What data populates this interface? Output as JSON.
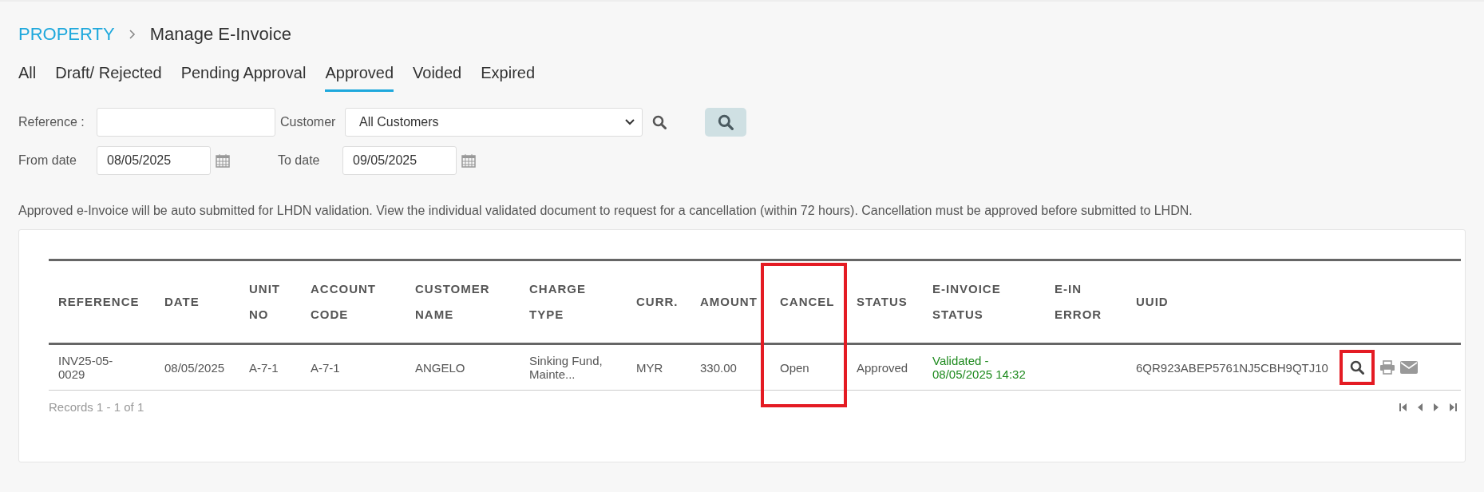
{
  "breadcrumb": {
    "parent": "PROPERTY",
    "current": "Manage E-Invoice"
  },
  "tabs": [
    {
      "label": "All",
      "selected": false
    },
    {
      "label": "Draft/ Rejected",
      "selected": false
    },
    {
      "label": "Pending Approval",
      "selected": false
    },
    {
      "label": "Approved",
      "selected": true
    },
    {
      "label": "Voided",
      "selected": false
    },
    {
      "label": "Expired",
      "selected": false
    }
  ],
  "filters": {
    "reference_label": "Reference :",
    "customer_label": "Customer",
    "customer_value": "All Customers",
    "from_label": "From date",
    "from_value": "08/05/2025",
    "to_label": "To date",
    "to_value": "09/05/2025"
  },
  "note": "Approved e-Invoice will be auto submitted for LHDN validation. View the individual validated document to request for a cancellation (within 72 hours). Cancellation must be approved before submitted to LHDN.",
  "table": {
    "columns": [
      {
        "lines": [
          "REFERENCE"
        ]
      },
      {
        "lines": [
          "DATE"
        ]
      },
      {
        "lines": [
          "UNIT",
          "NO"
        ]
      },
      {
        "lines": [
          "ACCOUNT",
          "CODE"
        ]
      },
      {
        "lines": [
          "CUSTOMER",
          "NAME"
        ]
      },
      {
        "lines": [
          "CHARGE",
          "TYPE"
        ]
      },
      {
        "lines": [
          "CURR."
        ]
      },
      {
        "lines": [
          "AMOUNT"
        ]
      },
      {
        "lines": [
          "CANCEL"
        ],
        "highlighted": true
      },
      {
        "lines": [
          "STATUS"
        ]
      },
      {
        "lines": [
          "E-INVOICE",
          "STATUS"
        ]
      },
      {
        "lines": [
          "E-IN",
          "ERROR"
        ]
      },
      {
        "lines": [
          "UUID"
        ]
      }
    ],
    "rows": [
      {
        "cells": [
          {
            "lines": [
              "INV25-05-",
              "0029"
            ],
            "kind": "plain"
          },
          {
            "lines": [
              "08/05/2025"
            ],
            "kind": "plain"
          },
          {
            "lines": [
              "A-7-1"
            ],
            "kind": "plain"
          },
          {
            "lines": [
              "A-7-1"
            ],
            "kind": "plain"
          },
          {
            "lines": [
              "ANGELO"
            ],
            "kind": "plain"
          },
          {
            "lines": [
              "Sinking Fund,",
              "Mainte..."
            ],
            "kind": "plain"
          },
          {
            "lines": [
              "MYR"
            ],
            "kind": "plain"
          },
          {
            "lines": [
              "330.00"
            ],
            "kind": "plain"
          },
          {
            "lines": [
              "Open"
            ],
            "kind": "plain"
          },
          {
            "lines": [
              "Approved"
            ],
            "kind": "plain"
          },
          {
            "lines": [
              "Validated -",
              "08/05/2025 14:32"
            ],
            "kind": "success"
          },
          {
            "kind": "empty"
          },
          {
            "lines": [
              "6QR923ABEP5761NJ5CBH9QTJ10"
            ],
            "kind": "plain"
          }
        ],
        "actions": [
          {
            "kind": "view",
            "highlighted": true
          },
          {
            "kind": "print",
            "highlighted": false
          },
          {
            "kind": "email",
            "highlighted": false
          }
        ]
      }
    ],
    "records": "Records 1 - 1 of 1"
  }
}
